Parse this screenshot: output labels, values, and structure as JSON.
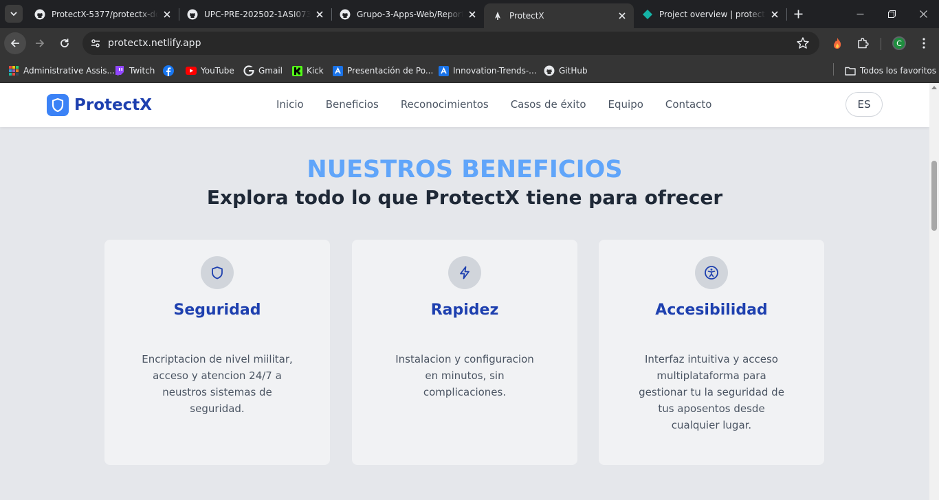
{
  "browser": {
    "tabs": [
      {
        "title": "ProtectX-5377/protectx-docs",
        "icon": "github-icon"
      },
      {
        "title": "UPC-PRE-202502-1ASI0730-",
        "icon": "github-icon"
      },
      {
        "title": "Grupo-3-Apps-Web/Report",
        "icon": "github-icon"
      },
      {
        "title": "ProtectX",
        "icon": "netlify-icon",
        "active": true
      },
      {
        "title": "Project overview | protectx |",
        "icon": "netlify-diamond-icon"
      }
    ],
    "url": "protectx.netlify.app",
    "profile_initial": "C",
    "bookmarks": [
      {
        "label": "Administrative Assis...",
        "icon": "grid-icon"
      },
      {
        "label": "Twitch",
        "icon": "twitch-icon"
      },
      {
        "label": "",
        "icon": "facebook-icon"
      },
      {
        "label": "YouTube",
        "icon": "youtube-icon"
      },
      {
        "label": "Gmail",
        "icon": "google-icon"
      },
      {
        "label": "Kick",
        "icon": "kick-icon"
      },
      {
        "label": "Presentación de Po...",
        "icon": "doc-icon"
      },
      {
        "label": "Innovation-Trends-...",
        "icon": "doc-icon"
      },
      {
        "label": "GitHub",
        "icon": "github-icon"
      }
    ],
    "all_bookmarks": "Todos los favoritos"
  },
  "site": {
    "brand": "ProtectX",
    "nav": [
      "Inicio",
      "Beneficios",
      "Reconocimientos",
      "Casos de éxito",
      "Equipo",
      "Contacto"
    ],
    "language": "ES",
    "eyebrow": "NUESTROS BENEFICIOS",
    "title": "Explora todo lo que ProtectX tiene para ofrecer",
    "benefits": [
      {
        "title": "Seguridad",
        "icon": "shield-icon",
        "description": "Encriptacion de nivel miilitar, acceso y atencion 24/7 a neustros sistemas de seguridad."
      },
      {
        "title": "Rapidez",
        "icon": "lightning-icon",
        "description": "Instalacion y configuracion en minutos, sin complicaciones."
      },
      {
        "title": "Accesibilidad",
        "icon": "accessibility-icon",
        "description": "Interfaz intuitiva y acceso multiplataforma para gestionar tu la seguridad de tus aposentos desde cualquier lugar."
      }
    ]
  },
  "colors": {
    "accent_light": "#60a5fa",
    "brand_dark": "#1e40af",
    "logo_bg": "#3b82f6"
  }
}
